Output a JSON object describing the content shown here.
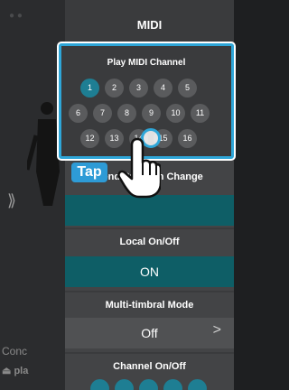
{
  "header": {
    "title": "MIDI"
  },
  "background": {
    "section_label": "Conc",
    "play_label": "pla"
  },
  "play_midi_channel": {
    "label": "Play MIDI Channel",
    "selected": "1",
    "row1": [
      "1",
      "2",
      "3",
      "4",
      "5"
    ],
    "row2": [
      "6",
      "7",
      "8",
      "9",
      "10",
      "11"
    ],
    "row3": [
      "12",
      "13",
      "14",
      "15",
      "16"
    ]
  },
  "send_program_change": {
    "label": "Send Program Change"
  },
  "local_on_off": {
    "label": "Local On/Off",
    "value": "ON"
  },
  "multi_timbral_mode": {
    "label": "Multi-timbral Mode",
    "value": "Off"
  },
  "channel_on_off": {
    "label": "Channel On/Off"
  },
  "overlay": {
    "tap_label": "Tap"
  },
  "colors": {
    "accent": "#2ea6d8",
    "selected_channel": "#1e7e93",
    "value_bar": "#0e5e66",
    "panel": "#3a3b3d"
  }
}
